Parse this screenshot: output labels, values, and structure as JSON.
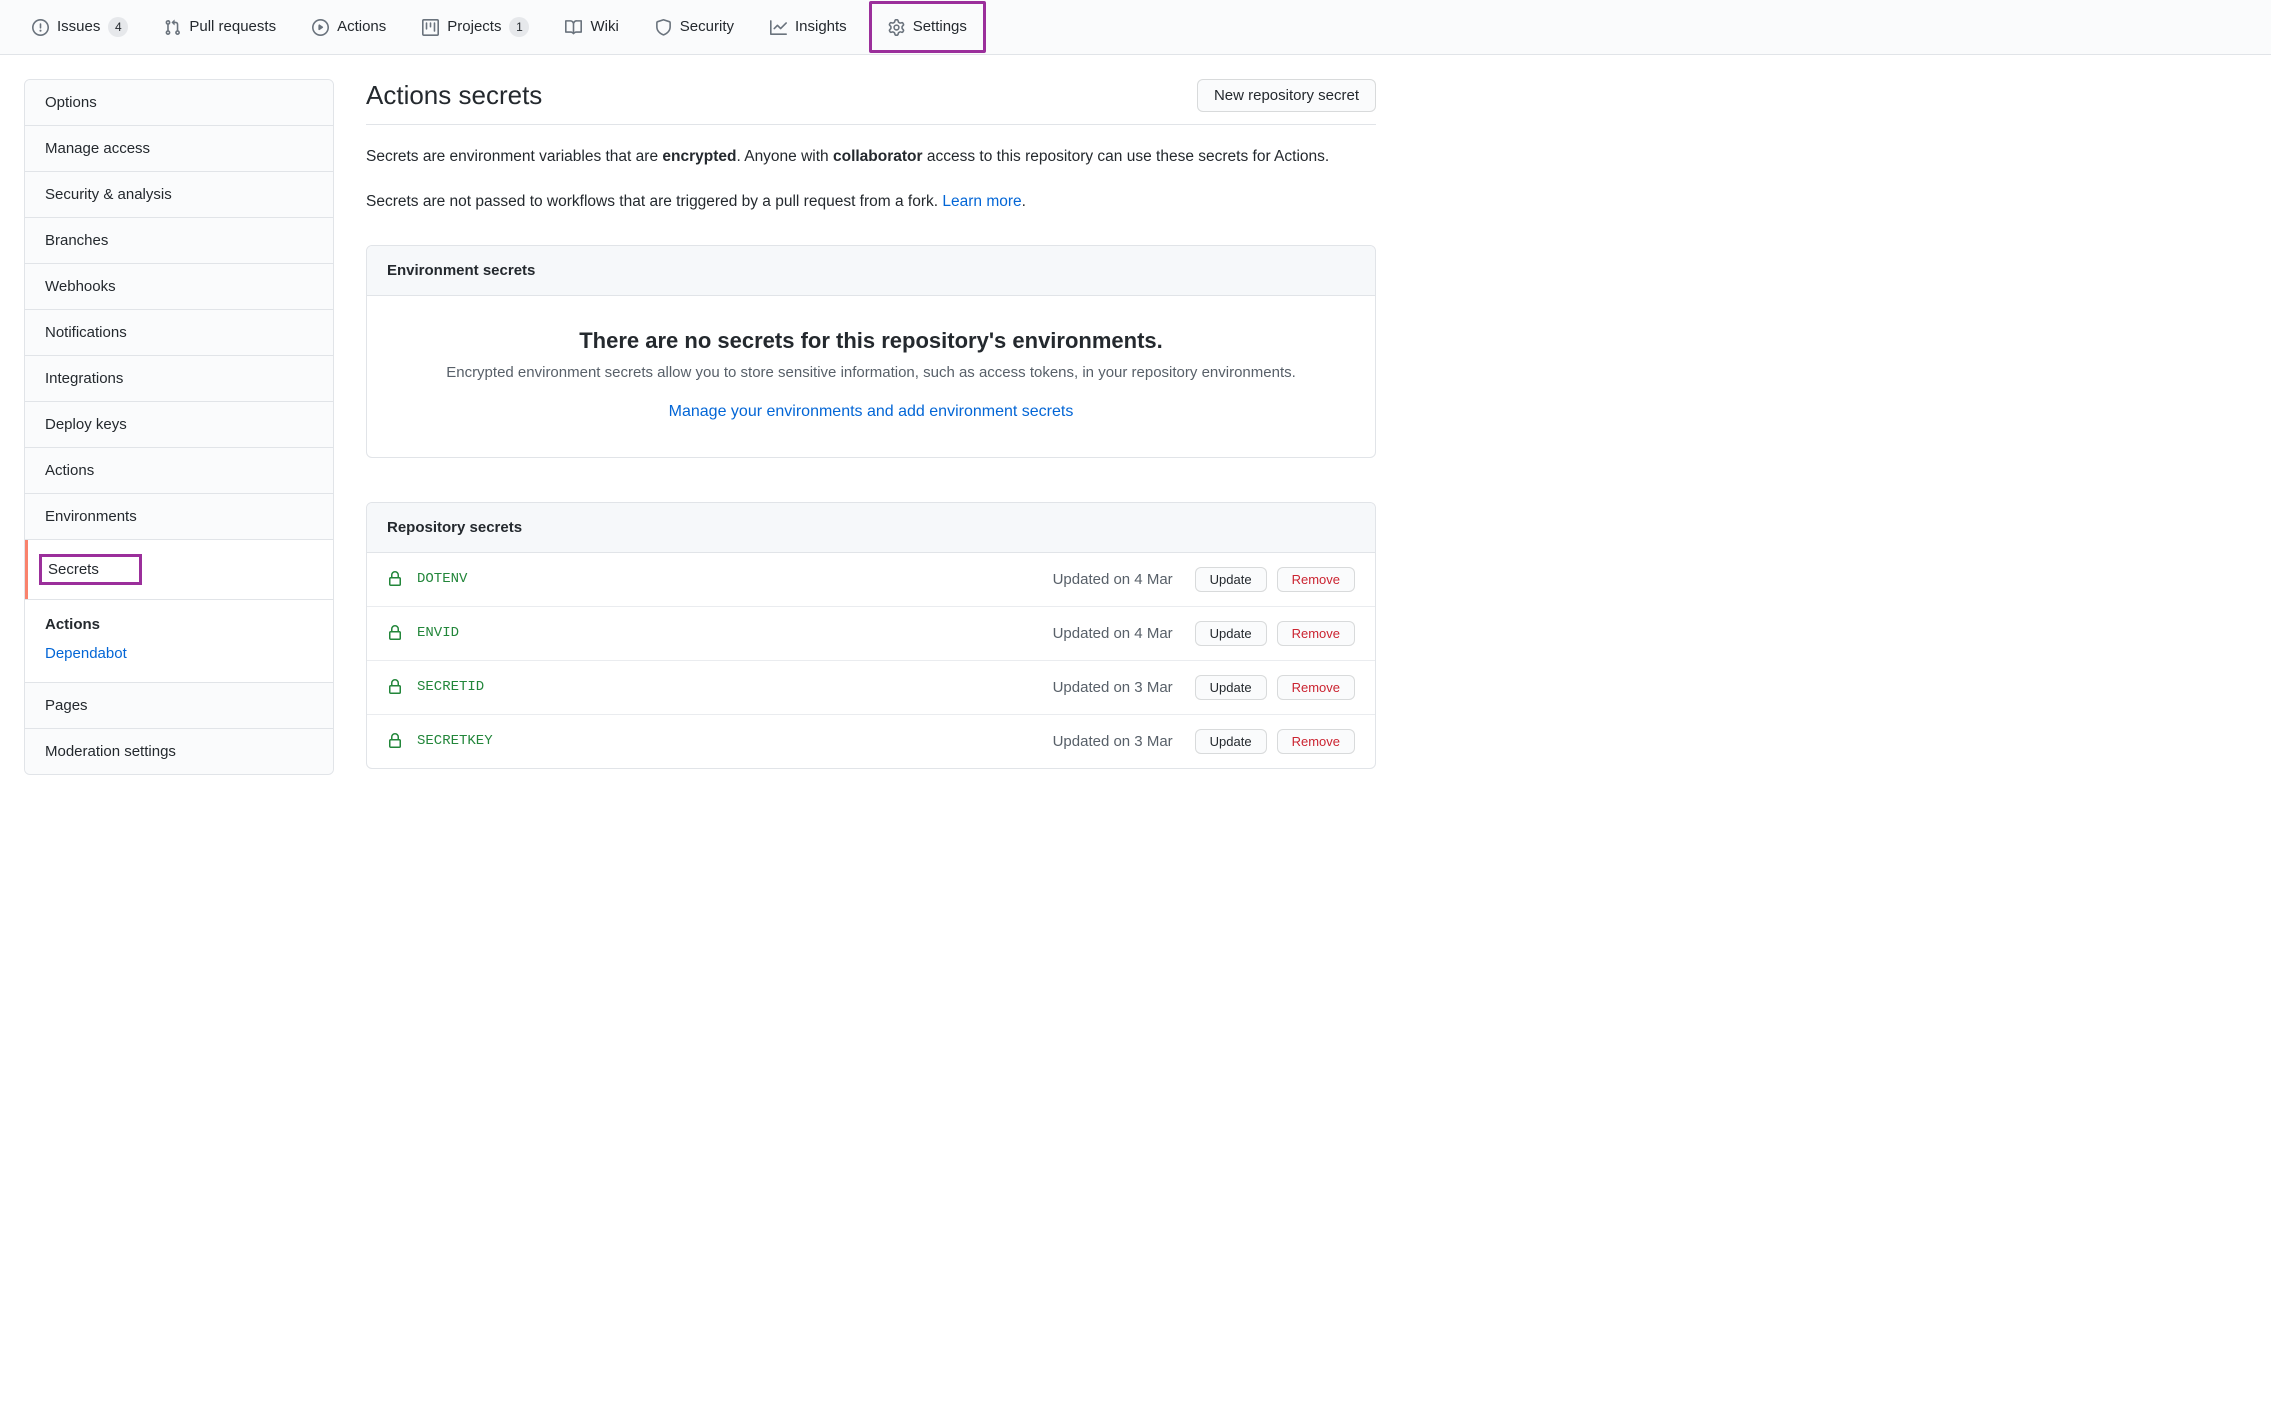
{
  "nav": {
    "issues": {
      "label": "Issues",
      "count": "4"
    },
    "pulls": {
      "label": "Pull requests"
    },
    "actions": {
      "label": "Actions"
    },
    "projects": {
      "label": "Projects",
      "count": "1"
    },
    "wiki": {
      "label": "Wiki"
    },
    "security": {
      "label": "Security"
    },
    "insights": {
      "label": "Insights"
    },
    "settings": {
      "label": "Settings"
    }
  },
  "sidebar": {
    "items": [
      "Options",
      "Manage access",
      "Security & analysis",
      "Branches",
      "Webhooks",
      "Notifications",
      "Integrations",
      "Deploy keys",
      "Actions",
      "Environments",
      "Secrets"
    ],
    "sub": {
      "actions": "Actions",
      "dependabot": "Dependabot"
    },
    "after": [
      "Pages",
      "Moderation settings"
    ]
  },
  "page": {
    "title": "Actions secrets",
    "new_secret_btn": "New repository secret",
    "intro1_a": "Secrets are environment variables that are ",
    "intro1_b": "encrypted",
    "intro1_c": ". Anyone with ",
    "intro1_d": "collaborator",
    "intro1_e": " access to this repository can use these secrets for Actions.",
    "intro2_a": "Secrets are not passed to workflows that are triggered by a pull request from a fork. ",
    "intro2_link": "Learn more",
    "intro2_b": "."
  },
  "env_panel": {
    "header": "Environment secrets",
    "blank_title": "There are no secrets for this repository's environments.",
    "blank_subtitle": "Encrypted environment secrets allow you to store sensitive information, such as access tokens, in your repository environments.",
    "blank_link": "Manage your environments and add environment secrets"
  },
  "repo_panel": {
    "header": "Repository secrets",
    "update_btn": "Update",
    "remove_btn": "Remove",
    "secrets": [
      {
        "name": "DOTENV",
        "updated": "Updated on 4 Mar"
      },
      {
        "name": "ENVID",
        "updated": "Updated on 4 Mar"
      },
      {
        "name": "SECRETID",
        "updated": "Updated on 3 Mar"
      },
      {
        "name": "SECRETKEY",
        "updated": "Updated on 3 Mar"
      }
    ]
  }
}
